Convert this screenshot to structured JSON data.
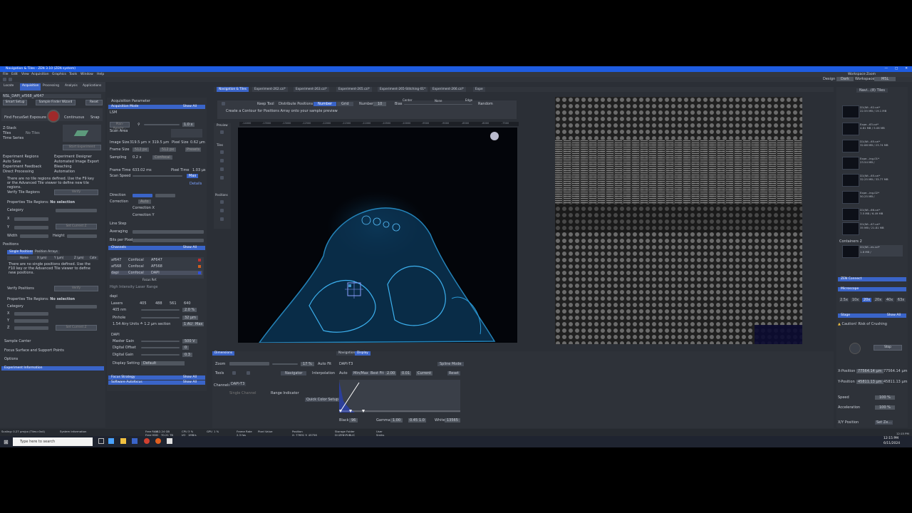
{
  "window": {
    "title": "Navigation & Tiles - ZEN 3.10 (ZEN system)"
  },
  "menu": [
    "File",
    "Edit",
    "View",
    "Acquisition",
    "Graphics",
    "Tools",
    "Window",
    "Help"
  ],
  "top_right": {
    "design_label": "Design",
    "design_value": "Dark",
    "workspace_label": "Workspace",
    "workspace_value": "MSL",
    "workspace_zoom": "Workspace Zoom"
  },
  "left_tabs": [
    "Locate",
    "Acquisition",
    "Processing",
    "Analysis",
    "Applications"
  ],
  "left": {
    "experiment_name": "NSL_DAPI_af568_af647",
    "smart_setup": "Smart Setup",
    "sample_finder": "Sample Finder Wizard",
    "reset": "Reset",
    "tools": [
      "Find Focus",
      "Set Exposure",
      "Live",
      "Continuous",
      "Snap"
    ],
    "z_stack": "Z-Stack",
    "tiles": "Tiles",
    "time_series": "Time Series",
    "no_tiles": "No Tiles",
    "start_experiment": "Start Experiment",
    "options_left": [
      "Experiment Regions",
      "Auto Save",
      "Experiment Feedback",
      "Direct Processing"
    ],
    "options_right": [
      "Experiment Designer",
      "Automated Image Export",
      "Bleaching",
      "Automation"
    ],
    "tile_regions_msg": "There are no tile regions defined. Use the F9 key or the Advanced Tile viewer to define new tile regions.",
    "verify_tile_regions": "Verify Tile Regions",
    "verify": "Verify",
    "properties_tile_regions": "Properties Tile Regions:",
    "no_selection": "No selection",
    "category": "Category",
    "x": "X",
    "y": "Y",
    "z": "Z",
    "width": "Width",
    "height": "Height",
    "set_current": "Set Current Z",
    "positions": "Positions",
    "single_positions": "Single Positions",
    "position_arrays": "Position Arrays",
    "name": "Name",
    "x_um": "X (µm)",
    "y_um": "Y (µm)",
    "z_um": "Z (µm)",
    "cat": "Cate",
    "positions_msg": "There are no single positions defined. Use the F10 key or the Advanced Tile viewer to define new positions.",
    "verify_positions": "Verify Positions",
    "properties_tile_regions2": "Properties Tile Regions:",
    "sample_carrier": "Sample Carrier",
    "focus_surface": "Focus Surface and Support Points",
    "options": "Options",
    "experiment_information": "Experiment Information"
  },
  "acq": {
    "title": "Acquisition Parameter",
    "mode": "Acquisition Mode",
    "show_all": "Show All",
    "lsm": "LSM",
    "objective": "Plan-Apochr...",
    "zoom_val": "1.0 x",
    "scan_area": "Scan Area",
    "image_size_label": "Image Size",
    "image_size": "319.5 µm × 319.5 µm",
    "pixel_size_label": "Pixel Size",
    "pixel_size": "0.62 µm",
    "frame_size_label": "Frame Size",
    "frame_size": "512 px",
    "frame_size2": "512 px",
    "presets": "Presets",
    "sampling_label": "Sampling",
    "sampling": "0.2 x",
    "confocal": "Confocal",
    "frame_time_label": "Frame Time",
    "frame_time": "633.02 ms",
    "pixel_time_label": "Pixel Time",
    "pixel_time": "1.03 µs",
    "scan_speed_label": "Scan Speed",
    "scan_speed": "Max",
    "details": "Details",
    "direction": "Direction",
    "correction": "Correction",
    "correction_auto": "Auto",
    "correction_x": "Correction X",
    "correction_y": "Correction Y",
    "line_step": "Line Step",
    "averaging": "Averaging",
    "bits": "Bits per Pixel",
    "channels": "Channels",
    "channel_rows": [
      {
        "name": "af647",
        "mode": "Confocal",
        "dye": "AF647",
        "color": "#c03030"
      },
      {
        "name": "af568",
        "mode": "Confocal",
        "dye": "AF568",
        "color": "#d06020"
      },
      {
        "name": "dapi",
        "mode": "Confocal",
        "dye": "DAPI",
        "color": "#3050e0"
      }
    ],
    "focus_ref": "Focus Ref.",
    "hilo": "High Intensity Laser Range",
    "dapi": "dapi",
    "lasers": "Lasers",
    "laser_lines": [
      "405",
      "488",
      "561",
      "640"
    ],
    "laser_nm": "405 nm",
    "laser_pct": "2.0 %",
    "pinhole": "Pinhole",
    "pinhole_val": "32 µm",
    "airy": "1.54 Airy Units ≙ 1.2 µm section",
    "au": "1 AU",
    "max": "Max",
    "detector": "DAPI",
    "master_gain": "Master Gain",
    "master_gain_val": "500 V",
    "digital_offset": "Digital Offset",
    "digital_offset_val": "0",
    "digital_gain": "Digital Gain",
    "digital_gain_val": "0.3",
    "display_setting": "Display Setting",
    "display_val": "Default",
    "focus_strategy": "Focus Strategy",
    "software_autofocus": "Software Autofocus"
  },
  "doc_tabs": [
    "Navigation & Tiles",
    "Experiment-262.czi*",
    "Experiment-263.czi*",
    "Experiment-265.czi*",
    "Experiment-265-Stitching-01*",
    "Experiment-266.czi*",
    "Expe"
  ],
  "viewer_toolbar": {
    "keep_tool": "Keep Tool",
    "distribute": "Distribute Positions by",
    "number": "Number",
    "grid": "Grid",
    "number_label": "Number",
    "number_val": "10",
    "bias": "Bias",
    "center": "Center",
    "none": "None",
    "edge": "Edge",
    "random": "Random",
    "hint": "Create a Contour for Positions Array onto your sample preview"
  },
  "side_labels": {
    "preview": "Preview",
    "tiles": "Tiles",
    "positions": "Positions"
  },
  "ruler": [
    "-14000",
    "-13500",
    "-13000",
    "-12500",
    "-12000",
    "-11500",
    "-11000",
    "-10500",
    "-10000",
    "-9500",
    "-9000",
    "-8500",
    "-8000",
    "-7500"
  ],
  "bottom_tabs": {
    "dimensions": "Dimensions",
    "navigation": "Navigation",
    "display": "Display"
  },
  "bottom": {
    "zoom": "Zoom",
    "zoom_val": "17 %",
    "auto_fit": "Auto Fit",
    "tools": "Tools",
    "navigator": "Navigator",
    "interpolation": "Interpolation",
    "channels": "Channels",
    "chan_sel": "DAPI-T3",
    "single_channel": "Single Channel",
    "range_indicator": "Range Indicator",
    "quick_color": "Quick Color Setup",
    "disp_channel": "DAPI-T3",
    "spline_mode": "Spline Mode",
    "auto": "Auto",
    "minmax": "Min/Max",
    "best_fit": "Best Fit",
    "bestfit_val": "2.00",
    "pct": "0.01",
    "current": "Current",
    "reset": "Reset",
    "black": "Black",
    "black_val": "96",
    "gamma": "Gamma",
    "gamma_val": "1.00",
    "gamma2": "0.45",
    "gamma3": "1.0",
    "white": "White",
    "white_val": "13565"
  },
  "right_panel": {
    "nav_tiles": "Navi...(8) Tiles",
    "containers": [
      {
        "name": "D1(Wi...62.czi*",
        "size": "22.55 MB / 19.1 MB"
      },
      {
        "name": "Expe...63.czi*",
        "size": "4.81 MB / 5.06 MB"
      },
      {
        "name": "D1(Wi...65.czi*",
        "size": "32.68 MB / 23.74 MB"
      },
      {
        "name": "Expe...ing-01*",
        "size": "23.54 MB / "
      },
      {
        "name": "D1(Wi...65.czi*",
        "size": "32.25 MB / 33.77 MB"
      },
      {
        "name": "Expe...ing-02*",
        "size": "50.25 MB / "
      },
      {
        "name": "D1(Wi...66.czi*",
        "size": "7.5 MB / 6.49 MB"
      },
      {
        "name": "D1(Wi...67.czi*",
        "size": "35 MB / 21.81 MB"
      }
    ],
    "containers2": "Containers 2",
    "c2_item": {
      "name": "D1(Wi...es.czi*",
      "size": "1.8 MB / "
    },
    "zen_connect": "ZEN Connect",
    "microscope": "Microscope",
    "objectives": [
      "2.5x",
      "10x",
      "20x",
      "20x",
      "40x",
      "63x"
    ],
    "stage": "Stage",
    "show_all": "Show All",
    "caution": "Caution! Risk of Crushing",
    "stop": "Stop",
    "x_position": "X-Position",
    "x_val": "77564.14 µm",
    "x_val2": "77564.14 µm",
    "y_position": "Y-Position",
    "y_val": "45811.13 µm",
    "y_val2": "45811.13 µm",
    "speed": "Speed",
    "speed_val": "100 %",
    "acceleration": "Acceleration",
    "accel_val": "100 %",
    "xy_position": "X/Y Position",
    "set_zero": "Set Ze..."
  },
  "status": {
    "scaling": "Scaling: 0.27 µm/px (Tiles=0x4)",
    "system_info": "System Information",
    "free_ram_label": "Free RAM",
    "free_ram": "112.24 GB",
    "free_hdd_label": "Free HDD",
    "free_hdd": "70.21 TB",
    "cpu_label": "CPU",
    "cpu": "3 %",
    "io_label": "I/O",
    "io": "1MB/s",
    "gpu_label": "GPU",
    "gpu": "1 %",
    "frame_rate_label": "Frame Rate",
    "frame_rate": "2.3 fps",
    "pixel_value": "Pixel Value",
    "position_label": "Position",
    "position": "X: 77691 Y: 45756",
    "storage_label": "Storage Folder",
    "storage": "D:\\ZEN\\PUBLIC",
    "user_label": "User",
    "user": "Smiks",
    "clock": "12:15 PM"
  },
  "taskbar": {
    "search": "Type here to search",
    "time": "12:15 PM",
    "date": "6/11/2024"
  }
}
